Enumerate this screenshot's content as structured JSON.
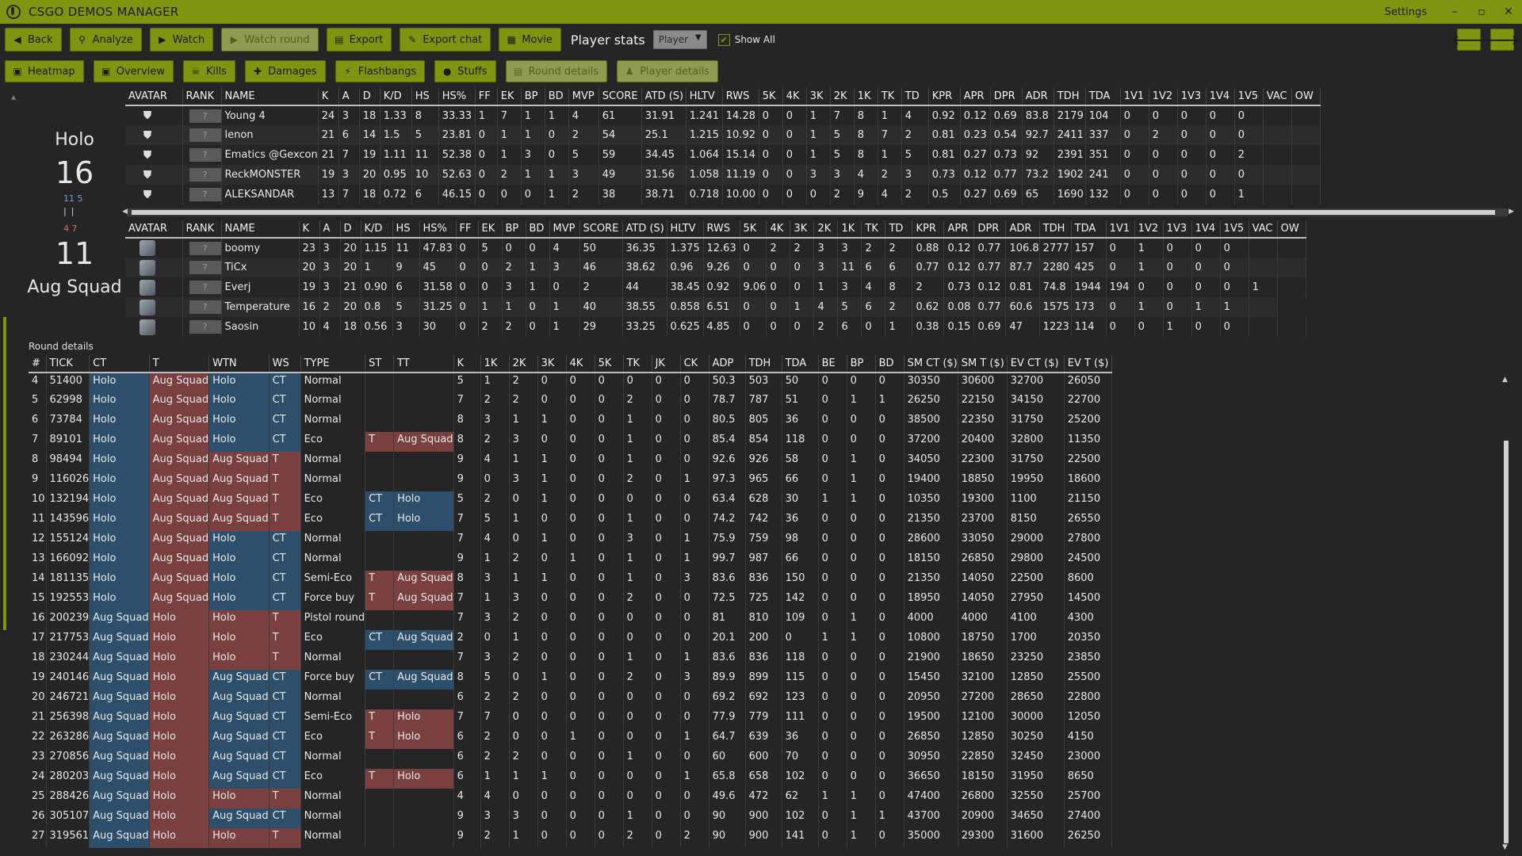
{
  "app": {
    "title": "CSGO DEMOS MANAGER",
    "settings": "Settings"
  },
  "window_controls": {
    "minimize": "–",
    "maximize": "▫",
    "close": "✕"
  },
  "toolbar": {
    "back": "Back",
    "analyze": "Analyze",
    "watch": "Watch",
    "watch_round": "Watch round",
    "export": "Export",
    "export_chat": "Export chat",
    "movie": "Movie",
    "player_stats_label": "Player stats",
    "player_select": "Player",
    "show_all": "Show All",
    "prev": "🡐",
    "next": "🡒"
  },
  "tabs": {
    "heatmap": "Heatmap",
    "overview": "Overview",
    "kills": "Kills",
    "damages": "Damages",
    "flashbangs": "Flashbangs",
    "stuffs": "Stuffs",
    "round_details": "Round details",
    "player_details": "Player details"
  },
  "teams": {
    "team1_name": "Holo",
    "team1_score": "16",
    "team1_half": "11 5",
    "team2_score": "11",
    "team2_half": "4 7",
    "team2_name": "Aug Squad"
  },
  "player_headers": [
    "AVATAR",
    "RANK",
    "NAME",
    "K",
    "A",
    "D",
    "K/D",
    "HS",
    "HS%",
    "FF",
    "EK",
    "BP",
    "BD",
    "MVP",
    "SCORE",
    "ATD (S)",
    "HLTV",
    "RWS",
    "5K",
    "4K",
    "3K",
    "2K",
    "1K",
    "TK",
    "TD",
    "KPR",
    "APR",
    "DPR",
    "ADR",
    "TDH",
    "TDA",
    "1V1",
    "1V2",
    "1V3",
    "1V4",
    "1V5",
    "VAC",
    "OW"
  ],
  "rank_placeholder": "?",
  "team1_players": [
    [
      "Young 4",
      "24",
      "3",
      "18",
      "1.33",
      "8",
      "33.33",
      "1",
      "7",
      "1",
      "1",
      "4",
      "61",
      "31.91",
      "1.241",
      "14.28",
      "0",
      "0",
      "1",
      "7",
      "8",
      "1",
      "4",
      "0.92",
      "0.12",
      "0.69",
      "83.8",
      "2179",
      "104",
      "0",
      "0",
      "0",
      "0",
      "0",
      "",
      ""
    ],
    [
      "lenon",
      "21",
      "6",
      "14",
      "1.5",
      "5",
      "23.81",
      "0",
      "1",
      "1",
      "0",
      "2",
      "54",
      "25.1",
      "1.215",
      "10.92",
      "0",
      "0",
      "1",
      "5",
      "8",
      "7",
      "2",
      "0.81",
      "0.23",
      "0.54",
      "92.7",
      "2411",
      "337",
      "0",
      "2",
      "0",
      "0",
      "0",
      "",
      ""
    ],
    [
      "Ematics @Gexcon",
      "21",
      "7",
      "19",
      "1.11",
      "11",
      "52.38",
      "0",
      "1",
      "3",
      "0",
      "5",
      "59",
      "34.45",
      "1.064",
      "15.14",
      "0",
      "0",
      "1",
      "5",
      "8",
      "1",
      "5",
      "0.81",
      "0.27",
      "0.73",
      "92",
      "2391",
      "351",
      "0",
      "0",
      "0",
      "0",
      "2",
      "",
      ""
    ],
    [
      "ReckMONSTER",
      "19",
      "3",
      "20",
      "0.95",
      "10",
      "52.63",
      "0",
      "2",
      "1",
      "1",
      "3",
      "49",
      "31.56",
      "1.058",
      "11.19",
      "0",
      "0",
      "3",
      "3",
      "4",
      "2",
      "3",
      "0.73",
      "0.12",
      "0.77",
      "73.2",
      "1902",
      "241",
      "0",
      "0",
      "0",
      "0",
      "0",
      "",
      ""
    ],
    [
      "ALEKSANDAR",
      "13",
      "7",
      "18",
      "0.72",
      "6",
      "46.15",
      "0",
      "0",
      "0",
      "1",
      "2",
      "38",
      "38.71",
      "0.718",
      "10.00",
      "0",
      "0",
      "0",
      "2",
      "9",
      "4",
      "2",
      "0.5",
      "0.27",
      "0.69",
      "65",
      "1690",
      "132",
      "0",
      "0",
      "0",
      "0",
      "1",
      "",
      ""
    ]
  ],
  "team2_players": [
    [
      "boomy",
      "23",
      "3",
      "20",
      "1.15",
      "11",
      "47.83",
      "0",
      "5",
      "0",
      "0",
      "4",
      "50",
      "36.35",
      "1.375",
      "12.63",
      "0",
      "2",
      "2",
      "3",
      "3",
      "2",
      "2",
      "0.88",
      "0.12",
      "0.77",
      "106.8",
      "2777",
      "157",
      "0",
      "1",
      "0",
      "0",
      "0",
      "",
      ""
    ],
    [
      "TiCx",
      "20",
      "3",
      "20",
      "1",
      "9",
      "45",
      "0",
      "0",
      "2",
      "1",
      "3",
      "46",
      "38.62",
      "0.96",
      "9.26",
      "0",
      "0",
      "0",
      "3",
      "11",
      "6",
      "6",
      "0.77",
      "0.12",
      "0.77",
      "87.7",
      "2280",
      "425",
      "0",
      "1",
      "0",
      "0",
      "0",
      "",
      ""
    ],
    [
      "Everj",
      "19",
      "3",
      "21",
      "0.90",
      "6",
      "31.58",
      "0",
      "0",
      "3",
      "1",
      "0",
      "2",
      "44",
      "38.45",
      "0.92",
      "9.06",
      "0",
      "0",
      "1",
      "3",
      "4",
      "8",
      "2",
      "0.73",
      "0.12",
      "0.81",
      "74.8",
      "1944",
      "194",
      "0",
      "0",
      "0",
      "0",
      "1",
      ""
    ],
    [
      "Temperature",
      "16",
      "2",
      "20",
      "0.8",
      "5",
      "31.25",
      "0",
      "1",
      "1",
      "0",
      "1",
      "40",
      "38.55",
      "0.858",
      "6.51",
      "0",
      "0",
      "1",
      "4",
      "5",
      "6",
      "2",
      "0.62",
      "0.08",
      "0.77",
      "60.6",
      "1575",
      "173",
      "0",
      "1",
      "0",
      "1",
      "1",
      ""
    ],
    [
      "Saosin",
      "10",
      "4",
      "18",
      "0.56",
      "3",
      "30",
      "0",
      "2",
      "2",
      "0",
      "1",
      "29",
      "33.25",
      "0.625",
      "4.85",
      "0",
      "0",
      "0",
      "2",
      "6",
      "0",
      "1",
      "0.38",
      "0.15",
      "0.69",
      "47",
      "1223",
      "114",
      "0",
      "0",
      "1",
      "0",
      "0",
      "",
      ""
    ]
  ],
  "round_details_title": "Round details",
  "round_headers": [
    "#",
    "TICK",
    "CT",
    "T",
    "WTN",
    "WS",
    "TYPE",
    "ST",
    "TT",
    "K",
    "1K",
    "2K",
    "3K",
    "4K",
    "5K",
    "TK",
    "JK",
    "CK",
    "ADP",
    "TDH",
    "TDA",
    "BE",
    "BP",
    "BD",
    "SM CT ($)",
    "SM T ($)",
    "EV CT ($)",
    "EV T ($)"
  ],
  "rounds": [
    [
      "4",
      "51400",
      "Holo",
      "Aug Squad",
      "Holo",
      "CT",
      "Normal",
      "",
      "",
      "5",
      "1",
      "2",
      "0",
      "0",
      "0",
      "0",
      "0",
      "0",
      "50.3",
      "503",
      "50",
      "0",
      "0",
      "0",
      "30350",
      "30600",
      "32700",
      "26050"
    ],
    [
      "5",
      "62998",
      "Holo",
      "Aug Squad",
      "Holo",
      "CT",
      "Normal",
      "",
      "",
      "7",
      "2",
      "2",
      "0",
      "0",
      "0",
      "2",
      "0",
      "0",
      "78.7",
      "787",
      "51",
      "0",
      "1",
      "1",
      "26250",
      "22150",
      "34150",
      "22700"
    ],
    [
      "6",
      "73784",
      "Holo",
      "Aug Squad",
      "Holo",
      "CT",
      "Normal",
      "",
      "",
      "8",
      "3",
      "1",
      "1",
      "0",
      "0",
      "1",
      "0",
      "0",
      "80.5",
      "805",
      "36",
      "0",
      "0",
      "0",
      "38500",
      "22350",
      "31750",
      "25200"
    ],
    [
      "7",
      "89101",
      "Holo",
      "Aug Squad",
      "Holo",
      "CT",
      "Eco",
      "T",
      "Aug Squad",
      "8",
      "2",
      "3",
      "0",
      "0",
      "0",
      "1",
      "0",
      "0",
      "85.4",
      "854",
      "118",
      "0",
      "0",
      "0",
      "37200",
      "20400",
      "32800",
      "11350"
    ],
    [
      "8",
      "98494",
      "Holo",
      "Aug Squad",
      "Aug Squad",
      "T",
      "Normal",
      "",
      "",
      "9",
      "4",
      "1",
      "1",
      "0",
      "0",
      "1",
      "0",
      "0",
      "92.6",
      "926",
      "58",
      "0",
      "1",
      "0",
      "34050",
      "22300",
      "31750",
      "22500"
    ],
    [
      "9",
      "116026",
      "Holo",
      "Aug Squad",
      "Aug Squad",
      "T",
      "Normal",
      "",
      "",
      "9",
      "0",
      "3",
      "1",
      "0",
      "0",
      "2",
      "0",
      "1",
      "97.3",
      "965",
      "66",
      "0",
      "1",
      "0",
      "19400",
      "18850",
      "19950",
      "18600"
    ],
    [
      "10",
      "132194",
      "Holo",
      "Aug Squad",
      "Aug Squad",
      "T",
      "Eco",
      "CT",
      "Holo",
      "5",
      "2",
      "0",
      "1",
      "0",
      "0",
      "0",
      "0",
      "0",
      "63.4",
      "628",
      "30",
      "1",
      "1",
      "0",
      "10350",
      "19300",
      "1100",
      "21150"
    ],
    [
      "11",
      "143596",
      "Holo",
      "Aug Squad",
      "Aug Squad",
      "T",
      "Eco",
      "CT",
      "Holo",
      "7",
      "5",
      "1",
      "0",
      "0",
      "0",
      "1",
      "0",
      "0",
      "74.2",
      "742",
      "36",
      "0",
      "0",
      "0",
      "21350",
      "23700",
      "8150",
      "26550"
    ],
    [
      "12",
      "155124",
      "Holo",
      "Aug Squad",
      "Holo",
      "CT",
      "Normal",
      "",
      "",
      "7",
      "4",
      "0",
      "1",
      "0",
      "0",
      "3",
      "0",
      "1",
      "75.9",
      "759",
      "98",
      "0",
      "0",
      "0",
      "28600",
      "33050",
      "29000",
      "27800"
    ],
    [
      "13",
      "166092",
      "Holo",
      "Aug Squad",
      "Holo",
      "CT",
      "Normal",
      "",
      "",
      "9",
      "1",
      "2",
      "0",
      "1",
      "0",
      "1",
      "0",
      "1",
      "99.7",
      "987",
      "66",
      "0",
      "0",
      "0",
      "18150",
      "26850",
      "29800",
      "24500"
    ],
    [
      "14",
      "181135",
      "Holo",
      "Aug Squad",
      "Holo",
      "CT",
      "Semi-Eco",
      "T",
      "Aug Squad",
      "8",
      "3",
      "1",
      "1",
      "0",
      "0",
      "1",
      "0",
      "3",
      "83.6",
      "836",
      "150",
      "0",
      "0",
      "0",
      "21350",
      "14050",
      "22500",
      "8600"
    ],
    [
      "15",
      "192553",
      "Holo",
      "Aug Squad",
      "Holo",
      "CT",
      "Force buy",
      "T",
      "Aug Squad",
      "7",
      "1",
      "3",
      "0",
      "0",
      "0",
      "2",
      "0",
      "0",
      "72.5",
      "725",
      "142",
      "0",
      "0",
      "0",
      "18950",
      "14050",
      "27950",
      "14500"
    ],
    [
      "16",
      "200239",
      "Aug Squad",
      "Holo",
      "Holo",
      "T",
      "Pistol round",
      "",
      "",
      "7",
      "3",
      "2",
      "0",
      "0",
      "0",
      "0",
      "0",
      "0",
      "81",
      "810",
      "109",
      "0",
      "1",
      "0",
      "4000",
      "4000",
      "4100",
      "4300"
    ],
    [
      "17",
      "217753",
      "Aug Squad",
      "Holo",
      "Holo",
      "T",
      "Eco",
      "CT",
      "Aug Squad",
      "2",
      "0",
      "1",
      "0",
      "0",
      "0",
      "0",
      "0",
      "0",
      "20.1",
      "200",
      "0",
      "1",
      "1",
      "0",
      "10800",
      "18750",
      "1700",
      "20350"
    ],
    [
      "18",
      "230244",
      "Aug Squad",
      "Holo",
      "Holo",
      "T",
      "Normal",
      "",
      "",
      "7",
      "3",
      "2",
      "0",
      "0",
      "0",
      "1",
      "0",
      "1",
      "83.6",
      "836",
      "118",
      "0",
      "0",
      "0",
      "21900",
      "18650",
      "23250",
      "23850"
    ],
    [
      "19",
      "240146",
      "Aug Squad",
      "Holo",
      "Aug Squad",
      "CT",
      "Force buy",
      "CT",
      "Aug Squad",
      "8",
      "5",
      "0",
      "1",
      "0",
      "0",
      "2",
      "0",
      "3",
      "89.9",
      "899",
      "115",
      "0",
      "0",
      "0",
      "15450",
      "32100",
      "12850",
      "25500"
    ],
    [
      "20",
      "246721",
      "Aug Squad",
      "Holo",
      "Aug Squad",
      "CT",
      "Normal",
      "",
      "",
      "6",
      "2",
      "2",
      "0",
      "0",
      "0",
      "0",
      "0",
      "0",
      "69.2",
      "692",
      "123",
      "0",
      "0",
      "0",
      "20950",
      "27200",
      "28650",
      "22800"
    ],
    [
      "21",
      "256398",
      "Aug Squad",
      "Holo",
      "Aug Squad",
      "CT",
      "Semi-Eco",
      "T",
      "Holo",
      "7",
      "7",
      "0",
      "0",
      "0",
      "0",
      "0",
      "0",
      "0",
      "77.9",
      "779",
      "111",
      "0",
      "0",
      "0",
      "19500",
      "12100",
      "30000",
      "12050"
    ],
    [
      "22",
      "263286",
      "Aug Squad",
      "Holo",
      "Aug Squad",
      "CT",
      "Eco",
      "T",
      "Holo",
      "6",
      "2",
      "0",
      "0",
      "1",
      "0",
      "0",
      "0",
      "1",
      "64.7",
      "639",
      "36",
      "0",
      "0",
      "0",
      "26850",
      "12850",
      "30250",
      "4150"
    ],
    [
      "23",
      "270856",
      "Aug Squad",
      "Holo",
      "Aug Squad",
      "CT",
      "Normal",
      "",
      "",
      "6",
      "2",
      "2",
      "0",
      "0",
      "0",
      "1",
      "0",
      "0",
      "60",
      "600",
      "70",
      "0",
      "0",
      "0",
      "30950",
      "22850",
      "32450",
      "23000"
    ],
    [
      "24",
      "280203",
      "Aug Squad",
      "Holo",
      "Aug Squad",
      "CT",
      "Eco",
      "T",
      "Holo",
      "6",
      "1",
      "1",
      "1",
      "0",
      "0",
      "0",
      "0",
      "1",
      "65.8",
      "658",
      "102",
      "0",
      "0",
      "0",
      "36650",
      "18150",
      "31950",
      "8650"
    ],
    [
      "25",
      "288426",
      "Aug Squad",
      "Holo",
      "Holo",
      "T",
      "Normal",
      "",
      "",
      "4",
      "4",
      "0",
      "0",
      "0",
      "0",
      "0",
      "0",
      "0",
      "49.6",
      "472",
      "62",
      "1",
      "1",
      "0",
      "47400",
      "26800",
      "32550",
      "25700"
    ],
    [
      "26",
      "305107",
      "Aug Squad",
      "Holo",
      "Aug Squad",
      "CT",
      "Normal",
      "",
      "",
      "9",
      "3",
      "3",
      "0",
      "0",
      "0",
      "1",
      "0",
      "0",
      "90",
      "900",
      "102",
      "0",
      "1",
      "1",
      "43700",
      "20900",
      "34650",
      "27400"
    ],
    [
      "27",
      "319561",
      "Aug Squad",
      "Holo",
      "Holo",
      "T",
      "Normal",
      "",
      "",
      "9",
      "2",
      "1",
      "0",
      "0",
      "0",
      "2",
      "0",
      "2",
      "90",
      "900",
      "141",
      "0",
      "1",
      "0",
      "35000",
      "29300",
      "31600",
      "26250"
    ]
  ],
  "colors": {
    "accent": "#7f9411",
    "ct": "#2d4f6b",
    "t": "#7a3f3f",
    "background": "#252525"
  }
}
